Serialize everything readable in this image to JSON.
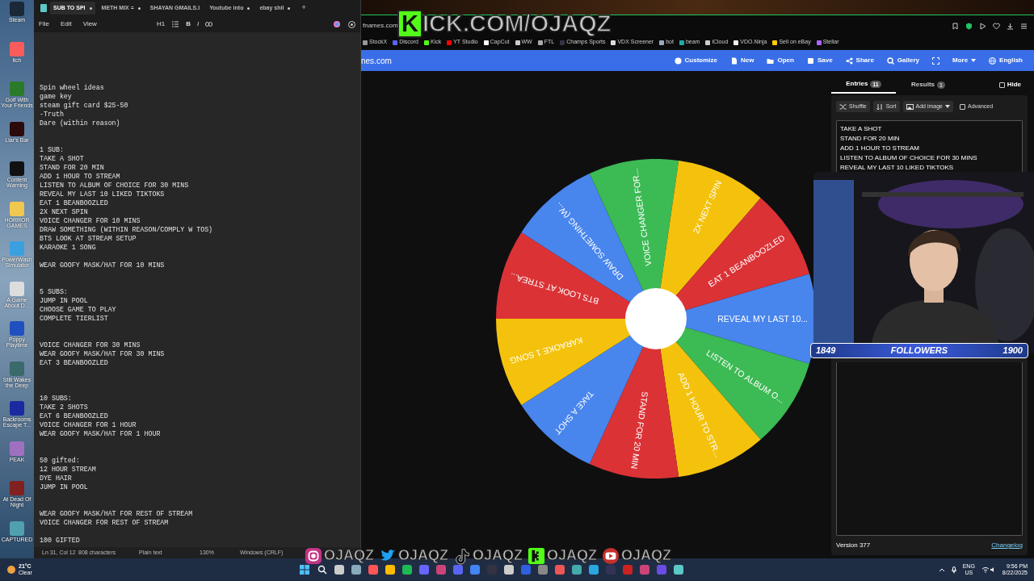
{
  "desktop_icons": [
    {
      "label": "Steam"
    },
    {
      "label": "itch"
    },
    {
      "label": "Golf With Your Friends"
    },
    {
      "label": "Liar's Bar"
    },
    {
      "label": "Content Warning"
    },
    {
      "label": "HORROR GAMES"
    },
    {
      "label": "PowerWash Simulator"
    },
    {
      "label": "A Game About D..."
    },
    {
      "label": "Poppy Playtime"
    },
    {
      "label": "Still Wakes the Deep"
    },
    {
      "label": "Backrooms Escape T..."
    },
    {
      "label": "PEAK"
    },
    {
      "label": "At Dead Of Night"
    },
    {
      "label": "CAPTURED"
    }
  ],
  "notepad": {
    "tabs": [
      {
        "title": "SUB TO SPI",
        "selected": true,
        "modified": true
      },
      {
        "title": "METH MIX =",
        "selected": false,
        "modified": true
      },
      {
        "title": "SHAYAN GMAILS.I",
        "selected": false,
        "modified": false
      },
      {
        "title": "Youtube into",
        "selected": false,
        "modified": true
      },
      {
        "title": "ebay shil",
        "selected": false,
        "modified": true
      }
    ],
    "new_tab": "+",
    "menu": [
      "File",
      "Edit",
      "View"
    ],
    "format_toolbar": {
      "heading": "H1",
      "bold": "B",
      "italic": "I"
    },
    "text": "Spin wheel ideas\ngame key\nsteam gift card $25-50\n-Truth\nDare (within reason)\n\n\n1 SUB:\nTAKE A SHOT\nSTAND FOR 20 MIN\nADD 1 HOUR TO STREAM\nLISTEN TO ALBUM OF CHOICE FOR 30 MINS\nREVEAL MY LAST 10 LIKED TIKTOKS\nEAT 1 BEANBOOZLED\n2X NEXT SPIN\nVOICE CHANGER FOR 10 MINS\nDRAW SOMETHING (WITHIN REASON/COMPLY W TOS)\nBTS LOOK AT STREAM SETUP\nKARAOKE 1 SONG\n\nWEAR GOOFY MASK/HAT FOR 10 MINS\n\n\n5 SUBS:\nJUMP IN POOL\nCHOOSE GAME TO PLAY\nCOMPLETE TIERLIST\n\n\nVOICE CHANGER FOR 30 MINS\nWEAR GOOFY MASK/HAT FOR 30 MINS\nEAT 3 BEANBOOZLED\n\n\n\n10 SUBS:\nTAKE 2 SHOTS\nEAT 6 BEANBOOZLED\nVOICE CHANGER FOR 1 HOUR\nWEAR GOOFY MASK/HAT FOR 1 HOUR\n\n\n50 gifted:\n12 HOUR STREAM\nDYE HAIR\nJUMP IN POOL\n\n\nWEAR GOOFY MASK/HAT FOR REST OF STREAM\nVOICE CHANGER FOR REST OF STREAM\n\n100 GIFTED",
    "status_bar": {
      "position": "Ln 31, Col 12",
      "characters": "808 characters",
      "format": "Plain text",
      "zoom": "130%",
      "line_endings": "Windows (CRLF)"
    }
  },
  "browser": {
    "address": "fnames.com",
    "bookmarks": [
      "StockX",
      "Discord",
      "Kick",
      "YT Studio",
      "CapCut",
      "WW",
      "FTL",
      "Champs Sports",
      "VDX Screener",
      "bot",
      "beam",
      "iCloud",
      "VDO.Ninja",
      "Sell on eBay",
      "Stellar"
    ],
    "toolbar": {
      "site": "nes.com",
      "buttons": [
        "Customize",
        "New",
        "Open",
        "Save",
        "Share",
        "Gallery"
      ],
      "more": "More",
      "language": "English"
    },
    "wheel": {
      "segments": [
        {
          "label": "REVEAL MY LAST 10...",
          "color": "#4885ed"
        },
        {
          "label": "LISTEN TO ALBUM O...",
          "color": "#3cba54"
        },
        {
          "label": "ADD 1 HOUR TO STR...",
          "color": "#f4c20d"
        },
        {
          "label": "STAND FOR 20 MIN",
          "color": "#db3236"
        },
        {
          "label": "TAKE A SHOT",
          "color": "#4885ed"
        },
        {
          "label": "KARAOKE 1 SONG",
          "color": "#f4c20d"
        },
        {
          "label": "BTS LOOK AT STREA...",
          "color": "#db3236"
        },
        {
          "label": "DRAW SOMETHING (W...",
          "color": "#4885ed"
        },
        {
          "label": "VOICE CHANGER FOR...",
          "color": "#3cba54"
        },
        {
          "label": "2X NEXT SPIN",
          "color": "#f4c20d"
        },
        {
          "label": "EAT 1 BEANBOOZLED",
          "color": "#db3236"
        }
      ]
    },
    "panel": {
      "tabs": [
        {
          "label": "Entries",
          "count": "11",
          "selected": true
        },
        {
          "label": "Results",
          "count": "1",
          "selected": false
        }
      ],
      "hide": {
        "label": "Hide",
        "checked": false
      },
      "actions": [
        "Shuffle",
        "Sort",
        "Add image"
      ],
      "advanced": {
        "label": "Advanced",
        "checked": false
      },
      "entries": [
        "TAKE A SHOT",
        "STAND FOR 20 MIN",
        "ADD 1 HOUR TO STREAM",
        "LISTEN TO ALBUM OF CHOICE FOR 30 MINS",
        "REVEAL MY LAST 10 LIKED TIKTOKS"
      ],
      "version": "Version 377",
      "changelog": "Changelog"
    }
  },
  "overlay": {
    "kick_logo": "K",
    "kick_url": "ICK.COM/OJAQZ",
    "follower_goal": {
      "current": "1849",
      "label": "FOLLOWERS",
      "goal": "1900"
    },
    "socials": [
      {
        "kind": "instagram",
        "handle": "OJAQZ"
      },
      {
        "kind": "twitter",
        "handle": "OJAQZ"
      },
      {
        "kind": "tiktok",
        "handle": "OJAQZ"
      },
      {
        "kind": "kick",
        "handle": "OJAQZ"
      },
      {
        "kind": "youtube",
        "handle": "OJAQZ"
      }
    ]
  },
  "taskbar": {
    "weather": {
      "temperature": "21°C",
      "condition": "Clear"
    },
    "language": "ENG",
    "region": "US",
    "time": "9:56 PM",
    "date": "8/22/2025"
  }
}
